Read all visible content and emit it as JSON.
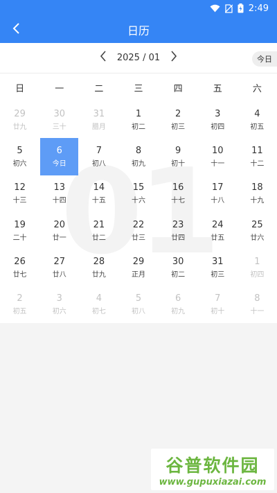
{
  "status_bar": {
    "time": "2:49"
  },
  "app_bar": {
    "title": "日历"
  },
  "month_nav": {
    "label": "2025 / 01",
    "today_label": "今日"
  },
  "watermark_month": "01",
  "weekdays": [
    "日",
    "一",
    "二",
    "三",
    "四",
    "五",
    "六"
  ],
  "days": [
    {
      "num": "29",
      "lunar": "廿九",
      "other": true
    },
    {
      "num": "30",
      "lunar": "三十",
      "other": true
    },
    {
      "num": "31",
      "lunar": "腊月",
      "other": true
    },
    {
      "num": "1",
      "lunar": "初二"
    },
    {
      "num": "2",
      "lunar": "初三"
    },
    {
      "num": "3",
      "lunar": "初四"
    },
    {
      "num": "4",
      "lunar": "初五"
    },
    {
      "num": "5",
      "lunar": "初六"
    },
    {
      "num": "6",
      "lunar": "今日",
      "selected": true
    },
    {
      "num": "7",
      "lunar": "初八"
    },
    {
      "num": "8",
      "lunar": "初九"
    },
    {
      "num": "9",
      "lunar": "初十"
    },
    {
      "num": "10",
      "lunar": "十一"
    },
    {
      "num": "11",
      "lunar": "十二"
    },
    {
      "num": "12",
      "lunar": "十三"
    },
    {
      "num": "13",
      "lunar": "十四"
    },
    {
      "num": "14",
      "lunar": "十五"
    },
    {
      "num": "15",
      "lunar": "十六"
    },
    {
      "num": "16",
      "lunar": "十七"
    },
    {
      "num": "17",
      "lunar": "十八"
    },
    {
      "num": "18",
      "lunar": "十九"
    },
    {
      "num": "19",
      "lunar": "二十"
    },
    {
      "num": "20",
      "lunar": "廿一"
    },
    {
      "num": "21",
      "lunar": "廿二"
    },
    {
      "num": "22",
      "lunar": "廿三"
    },
    {
      "num": "23",
      "lunar": "廿四"
    },
    {
      "num": "24",
      "lunar": "廿五"
    },
    {
      "num": "25",
      "lunar": "廿六"
    },
    {
      "num": "26",
      "lunar": "廿七"
    },
    {
      "num": "27",
      "lunar": "廿八"
    },
    {
      "num": "28",
      "lunar": "廿九"
    },
    {
      "num": "29",
      "lunar": "正月"
    },
    {
      "num": "30",
      "lunar": "初二"
    },
    {
      "num": "31",
      "lunar": "初三"
    },
    {
      "num": "1",
      "lunar": "初四",
      "other": true
    },
    {
      "num": "2",
      "lunar": "初五",
      "other": true
    },
    {
      "num": "3",
      "lunar": "初六",
      "other": true
    },
    {
      "num": "4",
      "lunar": "初七",
      "other": true
    },
    {
      "num": "5",
      "lunar": "初八",
      "other": true
    },
    {
      "num": "6",
      "lunar": "初九",
      "other": true
    },
    {
      "num": "7",
      "lunar": "初十",
      "other": true
    },
    {
      "num": "8",
      "lunar": "十一",
      "other": true
    }
  ],
  "watermark": {
    "title": "谷普软件园",
    "url": "www.gupuxiazai.com"
  },
  "colors": {
    "primary": "#3585f5",
    "selected": "#5e9cf6",
    "muted": "#c2c2c2",
    "watermark": "#6cb640"
  },
  "icons": {
    "back": "chevron-left-icon",
    "prev": "chevron-left-icon",
    "next": "chevron-right-icon"
  }
}
